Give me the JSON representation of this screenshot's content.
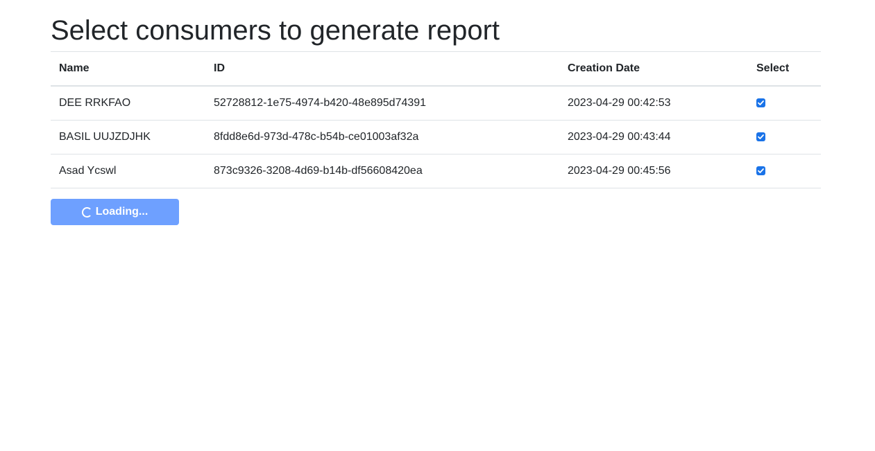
{
  "page": {
    "title": "Select consumers to generate report"
  },
  "table": {
    "headers": {
      "name": "Name",
      "id": "ID",
      "creation_date": "Creation Date",
      "select": "Select"
    },
    "rows": [
      {
        "name": "DEE RRKFAO",
        "id": "52728812-1e75-4974-b420-48e895d74391",
        "creation_date": "2023-04-29 00:42:53",
        "selected": true
      },
      {
        "name": "BASIL UUJZDJHK",
        "id": "8fdd8e6d-973d-478c-b54b-ce01003af32a",
        "creation_date": "2023-04-29 00:43:44",
        "selected": true
      },
      {
        "name": "Asad Ycswl",
        "id": "873c9326-3208-4d69-b14b-df56608420ea",
        "creation_date": "2023-04-29 00:45:56",
        "selected": true
      }
    ]
  },
  "action_button": {
    "label": "Loading...",
    "icon": "spinner-icon",
    "color": "#6ea0ff"
  },
  "colors": {
    "checkbox": "#1a73e8",
    "text": "#212529",
    "border": "#dee2e6"
  }
}
